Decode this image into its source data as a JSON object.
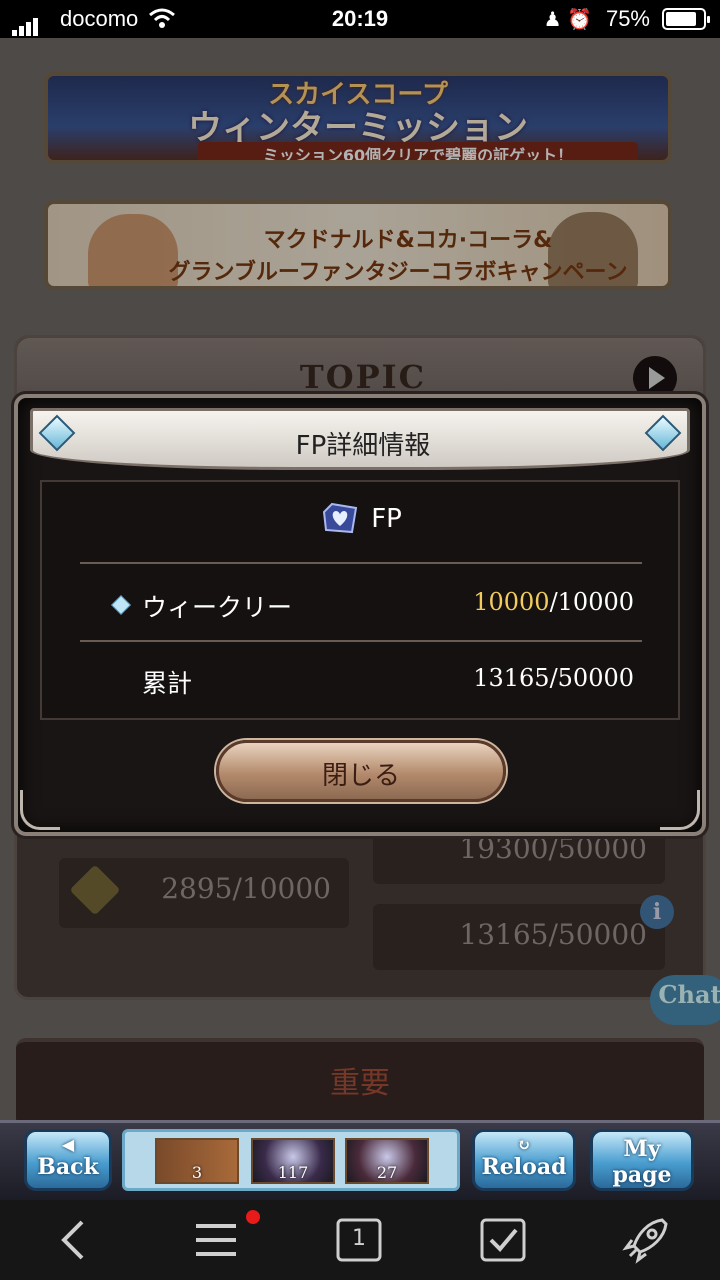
{
  "status_bar": {
    "carrier": "docomo",
    "time": "20:19",
    "battery": "75%"
  },
  "banners": {
    "winter": {
      "line1": "スカイスコープ",
      "line2": "ウィンターミッション",
      "line3": "ミッション60個クリアで碧麗の証ゲット！"
    },
    "collab": {
      "line1": "マクドナルド&コカ·コーラ&",
      "line2": "グランブルーファンタジーコラボキャンペーン"
    }
  },
  "topic": {
    "title": "TOPIC"
  },
  "background_stats": {
    "left_value": "2895/10000",
    "right_values": [
      "19300/50000",
      "13165/50000"
    ]
  },
  "important": {
    "label": "重要"
  },
  "chat": {
    "label": "Chat"
  },
  "modal": {
    "title": "FP詳細情報",
    "currency_label": "FP",
    "weekly": {
      "label": "ウィークリー",
      "current": "10000",
      "max": "/10000"
    },
    "total": {
      "label": "累計",
      "value": "13165/50000"
    },
    "close_label": "閉じる"
  },
  "navbar": {
    "back_label": "Back",
    "reload_label": "Reload",
    "mypage_label_1": "My",
    "mypage_label_2": "page",
    "items": [
      {
        "count": "3"
      },
      {
        "count": "117"
      },
      {
        "count": "27"
      }
    ]
  },
  "browser": {
    "tab_count": "1"
  },
  "colors": {
    "highlight": "#f2cb5c",
    "notification": "#e81a1a"
  }
}
